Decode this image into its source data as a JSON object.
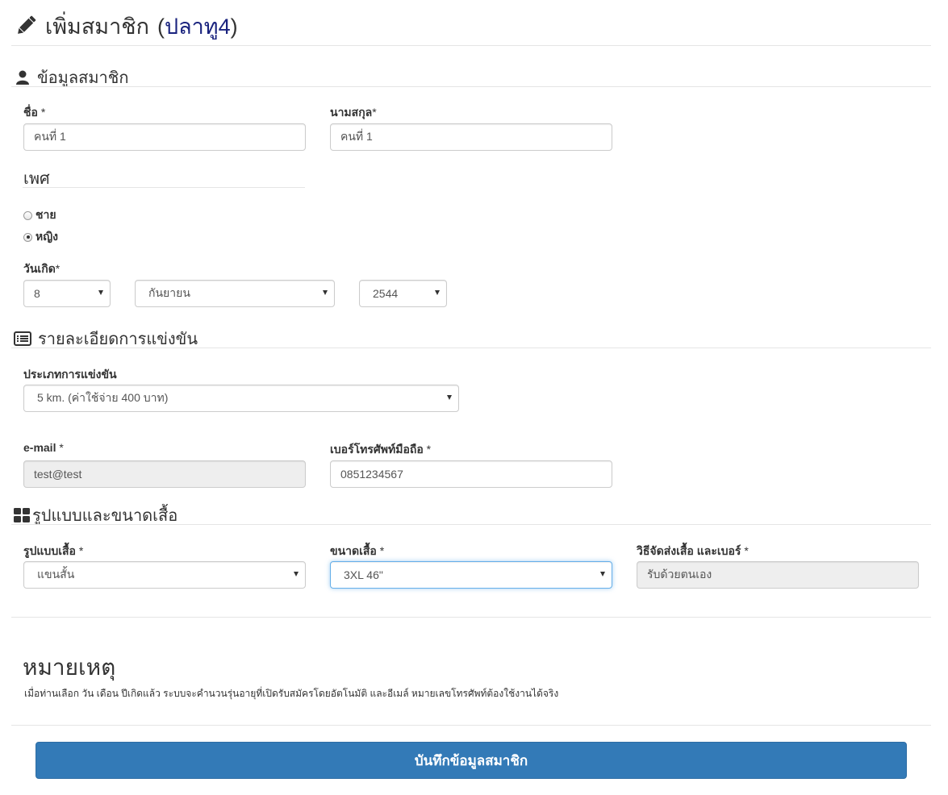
{
  "header": {
    "title": "เพิ่มสมาชิก",
    "open_paren": "(",
    "member_name": "ปลาทู4",
    "close_paren": ")",
    "icon": "pencil-icon"
  },
  "member_section": {
    "heading": "ข้อมูลสมาชิก",
    "icon": "user-icon",
    "first_name": {
      "label": "ชื่อ",
      "required": "*",
      "value": "คนที่ 1"
    },
    "last_name": {
      "label": "นามสกุล",
      "required": "*",
      "value": "คนที่ 1"
    },
    "sex": {
      "label": "เพศ",
      "options": [
        "ชาย",
        "หญิง"
      ],
      "selected": "หญิง"
    },
    "birthdate": {
      "label": "วันเกิด",
      "required": "*",
      "day": "8",
      "month": "กันยายน",
      "year": "2544"
    }
  },
  "race_section": {
    "heading": "รายละเอียดการแข่งขัน",
    "icon": "list-icon",
    "race_type": {
      "label": "ประเภทการแข่งขัน",
      "value": "5 km. (ค่าใช้จ่าย 400 บาท)"
    },
    "email": {
      "label": "e-mail",
      "required": "*",
      "value": "test@test"
    },
    "phone": {
      "label": "เบอร์โทรศัพท์มือถือ",
      "required": "*",
      "value": "0851234567"
    }
  },
  "shirt_section": {
    "heading": "รูปแบบและขนาดเสื้อ",
    "icon": "grid-icon",
    "style": {
      "label": "รูปแบบเสื้อ",
      "required": "*",
      "value": "แขนสั้น"
    },
    "size": {
      "label": "ขนาดเสื้อ",
      "required": "*",
      "value": "3XL 46\""
    },
    "delivery": {
      "label": "วิธีจัดส่งเสื้อ และเบอร์",
      "required": "*",
      "value": "รับด้วยตนเอง"
    }
  },
  "note": {
    "title": "หมายเหตุ",
    "text": "เมื่อท่านเลือก วัน เดือน ปีเกิดแล้ว ระบบจะคำนวนรุ่นอายุที่เปิดรับสมัครโดยอัตโนมัติ และอีเมล์ หมายเลขโทรศัพท์ต้องใช้งานได้จริง"
  },
  "submit_label": "บันทึกข้อมูลสมาชิก",
  "colors": {
    "primary": "#337ab7",
    "title_name": "#1a237e",
    "readonly_bg": "#eeeeee"
  }
}
